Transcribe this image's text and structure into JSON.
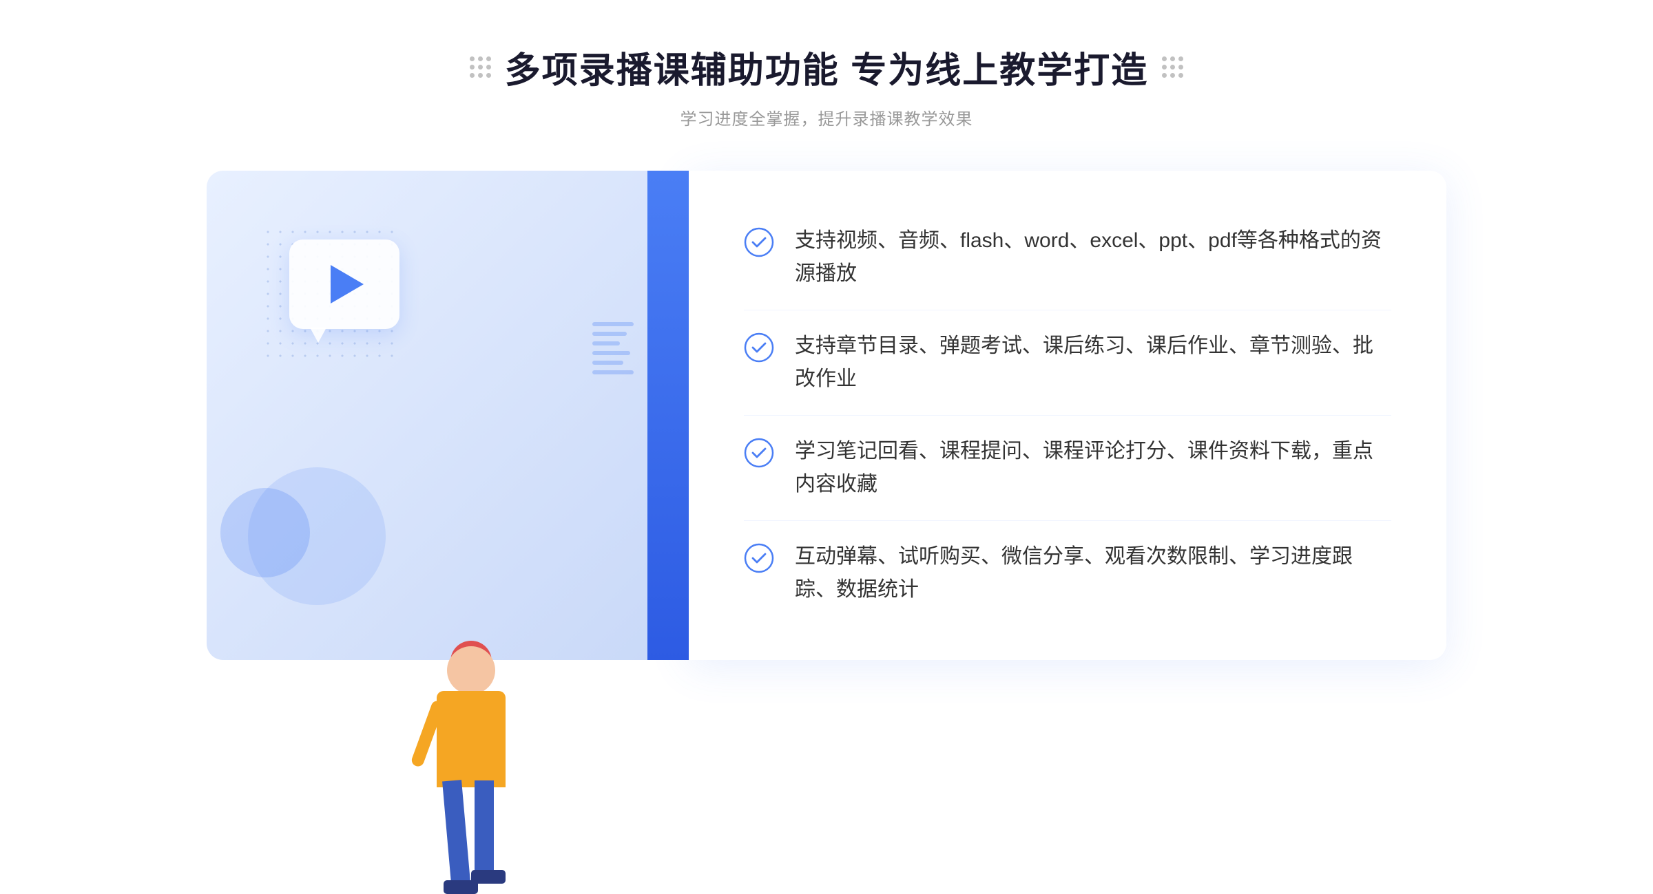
{
  "header": {
    "title": "多项录播课辅助功能 专为线上教学打造",
    "subtitle": "学习进度全掌握，提升录播课教学效果"
  },
  "features": [
    {
      "id": "feature-1",
      "text": "支持视频、音频、flash、word、excel、ppt、pdf等各种格式的资源播放"
    },
    {
      "id": "feature-2",
      "text": "支持章节目录、弹题考试、课后练习、课后作业、章节测验、批改作业"
    },
    {
      "id": "feature-3",
      "text": "学习笔记回看、课程提问、课程评论打分、课件资料下载，重点内容收藏"
    },
    {
      "id": "feature-4",
      "text": "互动弹幕、试听购买、微信分享、观看次数限制、学习进度跟踪、数据统计"
    }
  ],
  "decorations": {
    "chevron": "»",
    "chevron_left": "«"
  },
  "colors": {
    "primary": "#4a7ef5",
    "primary_dark": "#2d5be3",
    "text_dark": "#1a1a2e",
    "text_gray": "#999",
    "text_body": "#333"
  }
}
